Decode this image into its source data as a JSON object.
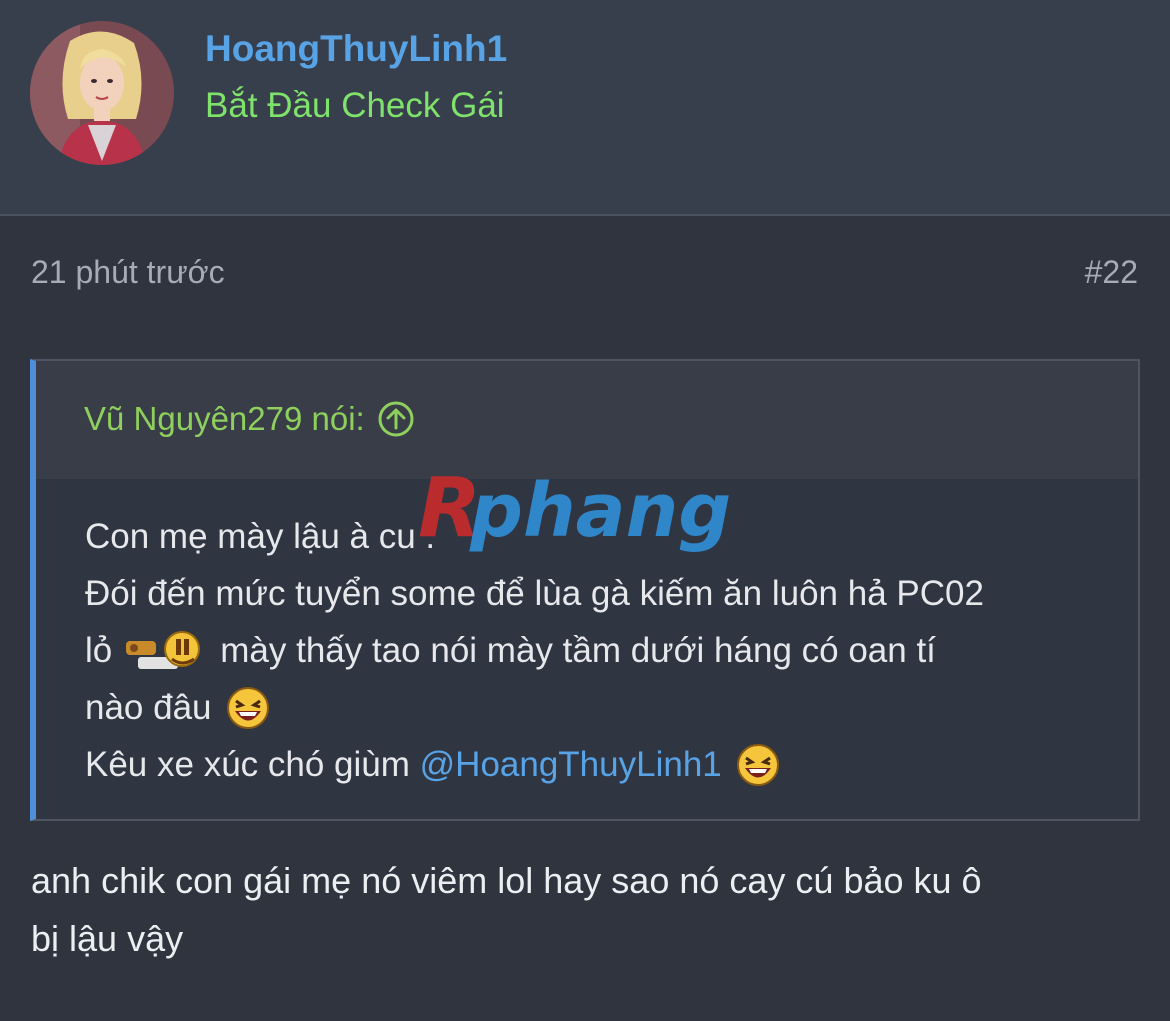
{
  "author": {
    "username": "HoangThuyLinh1",
    "title": "Bắt Đầu Check Gái"
  },
  "post": {
    "time": "21 phút trước",
    "number": "#22"
  },
  "quote": {
    "author_label": "Vũ Nguyên279 nói:",
    "lines": [
      "Con mẹ mày lậu à cu .",
      "Đói đến mức tuyển some để lùa gà kiếm ăn luôn hả PC02",
      "lỏ",
      "mày thấy tao nói mày tầm dưới háng có oan tí",
      "nào đâu",
      "Kêu xe xúc chó giùm",
      "@HoangThuyLinh1"
    ]
  },
  "reply": {
    "line1": "anh chik con gái mẹ nó viêm lol hay sao nó cay cú bảo ku ô",
    "line2": "bị lậu vậy"
  },
  "watermark": {
    "text": "Rphang"
  },
  "colors": {
    "username": "#58a3e6",
    "user_title": "#7fe26b",
    "quote_author": "#8fcf5e",
    "quote_accent": "#4f8fd9",
    "background": "#2f343f"
  },
  "icons": [
    "avatar",
    "arrow-up-circle-icon",
    "laughing-smiley-icon",
    "emote-icon"
  ]
}
